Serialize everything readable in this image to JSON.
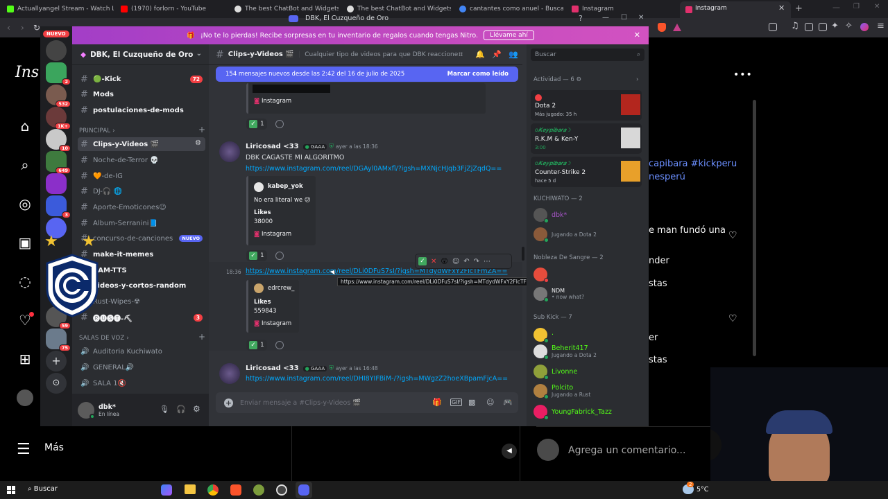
{
  "browser": {
    "tabs": [
      {
        "label": "Actuallyangel Stream - Watch Live o",
        "color": "#53fc18"
      },
      {
        "label": "(1970) forlorn - YouTube",
        "color": "#ff0000"
      },
      {
        "label": "The best ChatBot and Widgets for Ki",
        "color": "#ffffff"
      },
      {
        "label": "The best ChatBot and Widgets for Ki",
        "color": "#ffffff"
      },
      {
        "label": "cantantes como anuel - Buscar con G",
        "color": "#4285f4"
      },
      {
        "label": "Instagram",
        "color": "#e1306c"
      }
    ],
    "active_tab": "Instagram",
    "window_title": "DBK, El Cuzqueño de Oro"
  },
  "instagram": {
    "logo": "Ins",
    "more": "•••",
    "caption1": "capibara #kickperu",
    "caption2": "nesperú",
    "comment1": "e man fundó una",
    "comment2": "nder",
    "comment3": "stas",
    "comment4": "er",
    "comment5": "stas",
    "add_comment": "Agrega un comentario...",
    "more_label": "Más"
  },
  "discord": {
    "nitro_banner": "¡No te lo pierdas! Recibe sorpresas en tu inventario de regalos cuando tengas Nitro.",
    "nitro_claim": "Llévame ahí",
    "new_label": "NUEVO",
    "server_badges": [
      "2",
      "532",
      "1K+",
      "10",
      "649",
      "3",
      "59",
      "75"
    ],
    "server_name": "DBK, El Cuzqueño de Oro",
    "channels_top": [
      {
        "name": "🟢-Kick",
        "count": "72",
        "bold": true
      },
      {
        "name": "Mods",
        "bold": true
      },
      {
        "name": "postulaciones-de-mods",
        "bold": true
      }
    ],
    "category_principal": "PRINCIPAL",
    "channels_principal": [
      {
        "name": "Clips-y-Videos 🎬",
        "selected": true
      },
      {
        "name": "Noche-de-Terror 💀"
      },
      {
        "name": "🧡-de-IG"
      },
      {
        "name": "DJ-🎧 🌐"
      },
      {
        "name": "Aporte-Emoticones😉"
      },
      {
        "name": "Album-Serranini📘"
      },
      {
        "name": "concurso-de-canciones",
        "nuevo": "NUEVO"
      },
      {
        "name": "make-it-memes",
        "bold": true
      },
      {
        "name": "SAM-TTS",
        "bold": true
      },
      {
        "name": "videos-y-cortos-random",
        "bold": true
      },
      {
        "name": "Rust-Wipes-☢"
      },
      {
        "name": "🅡🅤🅢🅣-⛏",
        "count": "3",
        "bold": true
      }
    ],
    "category_voice": "SALAS DE VOZ",
    "voice_channels": [
      "Auditoria Kuchiwato",
      "GENERAL🔊",
      "SALA 1🔇"
    ],
    "user": {
      "name": "dbk*",
      "status": "En línea"
    },
    "chat": {
      "channel": "Clips-y-Videos 🎬",
      "topic": "Cualquier tipo de videos para que DBK reaccione",
      "search": "Buscar",
      "new_messages": "154 mensajes nuevos desde las 2:42 del 16 de julio de 2025",
      "mark_read": "Marcar como leído",
      "messages": [
        {
          "author": "Liricosad <33",
          "tag": "GAAA",
          "time": "ayer a las 18:36",
          "text": "DBK CAGASTE MI ALGORITMO",
          "link": "https://www.instagram.com/reel/DGAyl0AMxfl/?igsh=MXNjcHJqb3FjZjZqdQ==",
          "embed": {
            "user": "kabep_yok",
            "caption": "No era literal we 😕",
            "likes_label": "Likes",
            "likes": "38000",
            "source": "Instagram"
          },
          "reaction": "1"
        },
        {
          "time": "18:36",
          "link": "https://www.instagram.com/reel/DLi0DFuS7sI/?igsh=MTdydWFxY2FlcTFmZA==",
          "tooltip": "https://www.instagram.com/reel/DLi0DFuS7sI/?igsh=MTdydWFxY2FlcTFmZA==",
          "embed": {
            "user": "edrcrew_",
            "likes_label": "Likes",
            "likes": "559843",
            "source": "Instagram"
          },
          "reaction": "1"
        },
        {
          "author": "Liricosad <33",
          "tag": "GAAA",
          "time": "ayer a las 16:48",
          "link": "https://www.instagram.com/reel/DHI8YIFBiM-/?igsh=MWgzZ2hoeXBpamFjcA=="
        }
      ],
      "prev_source": "Instagram",
      "prev_reaction": "1",
      "input_placeholder": "Enviar mensaje a #Clips-y-Videos 🎬"
    },
    "members": {
      "search": "Buscar",
      "activity_header": "Actividad — 6",
      "activities": [
        {
          "user": "",
          "title": "Dota 2",
          "sub": "Más jugado: 35 h"
        },
        {
          "user": "ᴏ𝑲𝒆𝒚𝒑𝒊𝒃𝒂𝒓𝒂☽",
          "title": "R.K.M & Ken-Y",
          "sub": "3:00"
        },
        {
          "user": "ᴏ𝑲𝒆𝒚𝒑𝒊𝒃𝒂𝒓𝒂☽",
          "title": "Counter-Strike 2",
          "sub": "hace 5 d"
        }
      ],
      "groups": [
        {
          "name": "KUCHIWATO — 2",
          "items": [
            {
              "name": "dbk*",
              "sub": "",
              "color": "#a855c9"
            },
            {
              "name": "",
              "sub": "Jugando a Dota 2",
              "color": "#e67e22"
            }
          ]
        },
        {
          "name": "Nobleza De Sangre — 2",
          "items": [
            {
              "name": "",
              "sub": "",
              "color": "#e74c3c"
            },
            {
              "name": "NDM",
              "sub": "• now what?",
              "color": "#f2f3f5"
            }
          ]
        },
        {
          "name": "Sub Kick — 7",
          "items": [
            {
              "name": "·",
              "sub": "",
              "color": "#53fc18"
            },
            {
              "name": "Beherit417",
              "sub": "Jugando a Dota 2",
              "color": "#53fc18"
            },
            {
              "name": "Livonne",
              "sub": "",
              "color": "#53fc18"
            },
            {
              "name": "Polcito",
              "sub": "Jugando a Rust",
              "color": "#53fc18"
            },
            {
              "name": "YoungFabrick_Tazz",
              "sub": "",
              "color": "#53fc18"
            }
          ]
        }
      ]
    }
  },
  "taskbar": {
    "search": "Buscar",
    "temp": "5°C",
    "weather_badge": "2"
  }
}
